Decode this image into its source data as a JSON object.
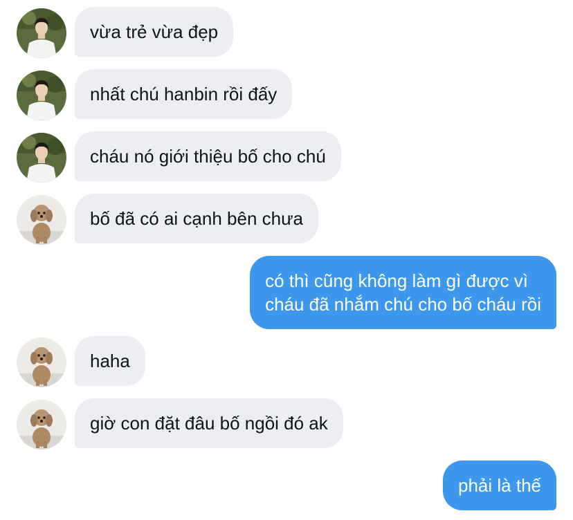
{
  "colors": {
    "received_bubble": "#eceef1",
    "sent_bubble": "#3d97ec",
    "received_text": "#0f1419",
    "sent_text": "#ffffff"
  },
  "avatars": {
    "person": "boy-in-white-shirt-avatar",
    "dog": "poodle-dog-avatar"
  },
  "messages": [
    {
      "sender": "person",
      "text": "vừa trẻ vừa đẹp"
    },
    {
      "sender": "person",
      "text": "nhất chú hanbin rồi đấy"
    },
    {
      "sender": "person",
      "text": "cháu nó giới thiệu bố cho chú"
    },
    {
      "sender": "dog",
      "text": "bố đã có ai cạnh bên chưa"
    },
    {
      "sender": "me",
      "lines": [
        "có thì cũng không làm gì được vì",
        "cháu đã nhắm chú cho bố cháu rồi"
      ]
    },
    {
      "sender": "dog",
      "text": "haha"
    },
    {
      "sender": "dog",
      "text": "giờ con đặt đâu bố ngồi đó ak"
    },
    {
      "sender": "me",
      "text": "phải là thế"
    }
  ]
}
